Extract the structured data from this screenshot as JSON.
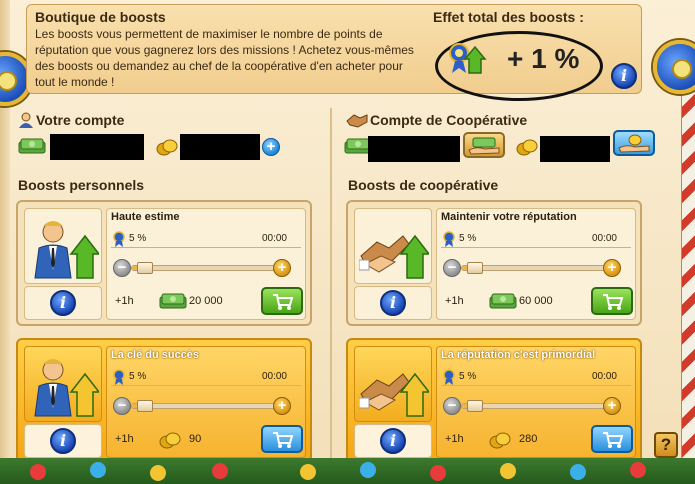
{
  "header": {
    "title": "Boutique de boosts",
    "description": "Les boosts vous permettent de maximiser le nombre de points de réputation que vous gagnerez lors des missions ! Achetez vous-mêmes des boosts ou demandez au chef de la coopérative d'en acheter pour tout le monde !",
    "effect_title": "Effet total des boosts :",
    "effect_value": "+ 1 %"
  },
  "account": {
    "personal_title": "Votre compte",
    "coop_title": "Compte de Coopérative"
  },
  "personal": {
    "section_title": "Boosts personnels",
    "cards": [
      {
        "title": "Haute estime",
        "percent": "5 %",
        "timer": "00:00",
        "duration": "+1h",
        "cost": "20 000",
        "currency": "money",
        "style": "normal",
        "buy_color": "green"
      },
      {
        "title": "La clé du succès",
        "percent": "5 %",
        "timer": "00:00",
        "duration": "+1h",
        "cost": "90",
        "currency": "coin",
        "style": "gold",
        "buy_color": "blue"
      }
    ]
  },
  "coop": {
    "section_title": "Boosts de coopérative",
    "cards": [
      {
        "title": "Maintenir votre réputation",
        "percent": "5 %",
        "timer": "00:00",
        "duration": "+1h",
        "cost": "60 000",
        "currency": "money",
        "style": "normal",
        "buy_color": "green"
      },
      {
        "title": "La réputation c'est primordial",
        "percent": "5 %",
        "timer": "00:00",
        "duration": "+1h",
        "cost": "280",
        "currency": "coin",
        "style": "gold",
        "buy_color": "blue"
      }
    ]
  },
  "help": {
    "label": "?"
  },
  "icons": {
    "info": "info-icon",
    "money": "money-icon",
    "coin": "coin-icon",
    "cart": "cart-icon",
    "ribbon": "ribbon-icon"
  },
  "colors": {
    "gold_card": "#f5a613",
    "buy_green": "#4aa418",
    "buy_blue": "#2b8fdc",
    "info_blue": "#1946b4"
  }
}
